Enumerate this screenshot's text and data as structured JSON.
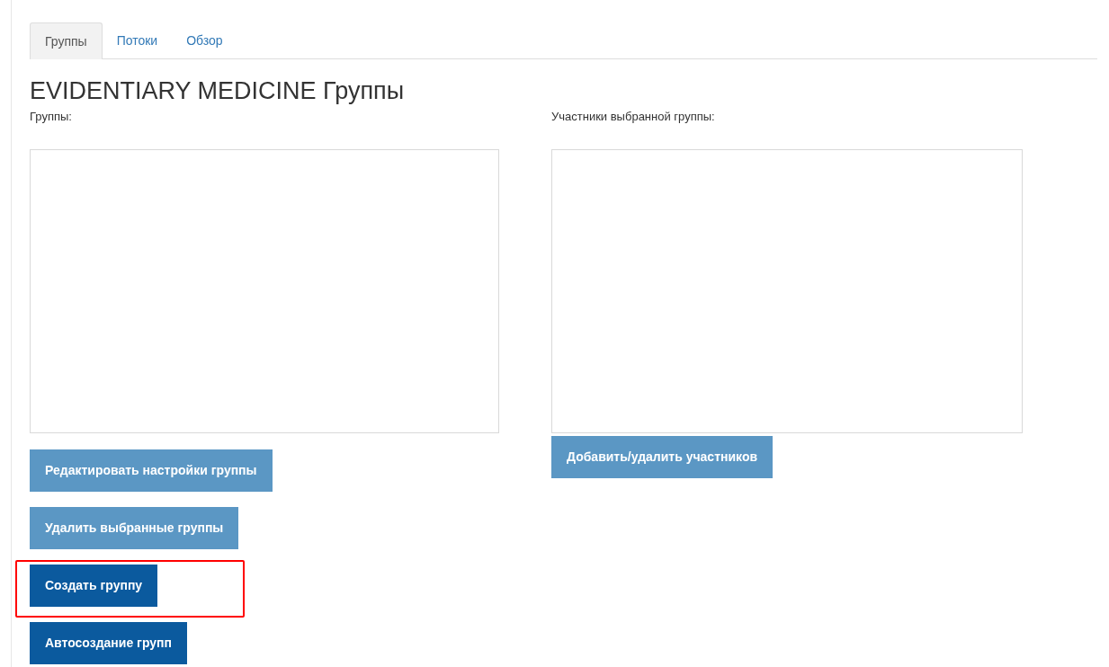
{
  "tabs": [
    {
      "label": "Группы",
      "selected": true
    },
    {
      "label": "Потоки",
      "selected": false
    },
    {
      "label": "Обзор",
      "selected": false
    }
  ],
  "heading": "EVIDENTIARY MEDICINE Группы",
  "groups_panel": {
    "label": "Группы:",
    "buttons": [
      {
        "label": "Редактировать настройки группы",
        "disabled": true,
        "highlighted": false
      },
      {
        "label": "Удалить выбранные группы",
        "disabled": true,
        "highlighted": false
      },
      {
        "label": "Создать группу",
        "disabled": false,
        "highlighted": true
      },
      {
        "label": "Автосоздание групп",
        "disabled": false,
        "highlighted": false
      }
    ]
  },
  "members_panel": {
    "label": "Участники выбранной группы:",
    "buttons": [
      {
        "label": "Добавить/удалить участников",
        "disabled": true,
        "highlighted": false
      }
    ]
  }
}
